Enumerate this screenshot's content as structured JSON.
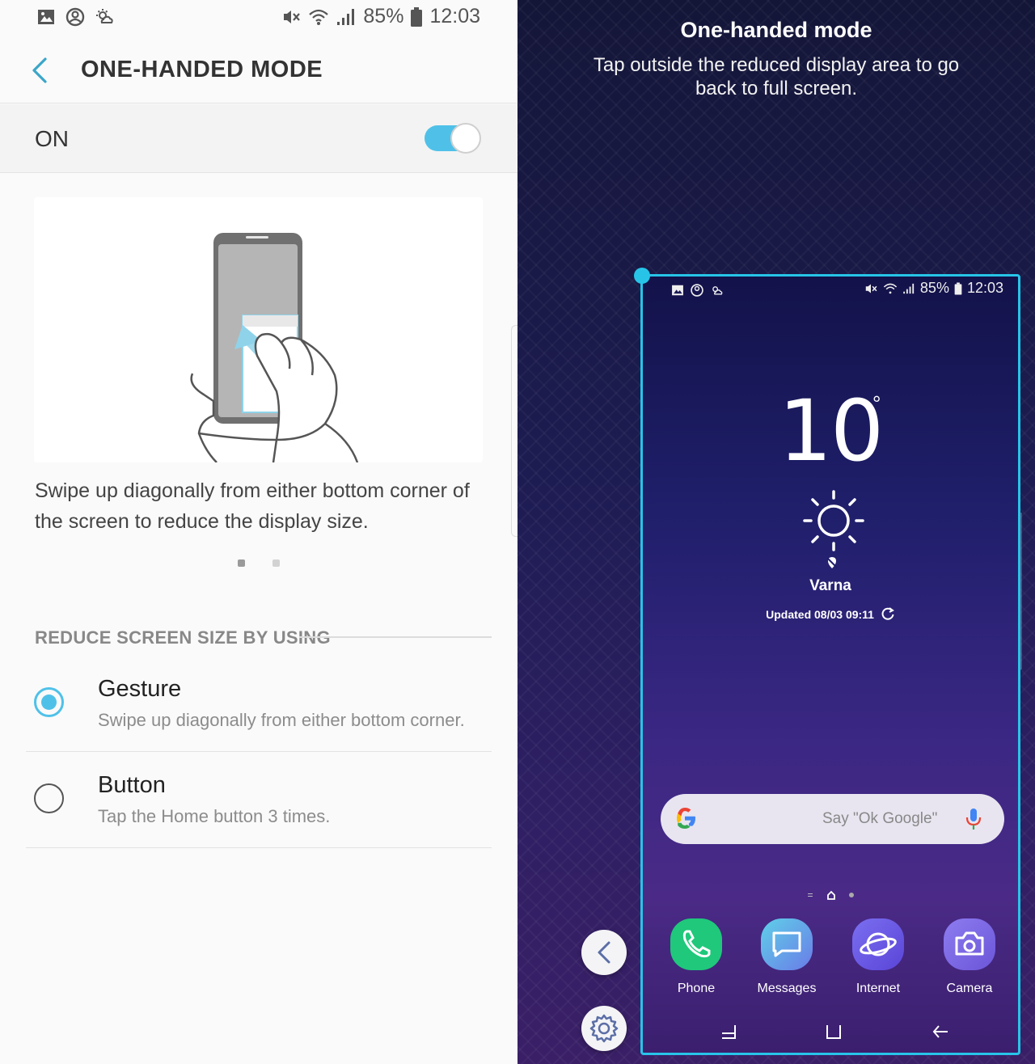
{
  "left": {
    "status": {
      "battery": "85%",
      "time": "12:03"
    },
    "header": {
      "title": "ONE-HANDED MODE"
    },
    "switch": {
      "label": "ON",
      "checked": true,
      "accent": "#4fc1e9"
    },
    "description": "Swipe up diagonally from either bottom corner of the screen to reduce the display size.",
    "pager": {
      "count": 2,
      "active": 0
    },
    "section_title": "REDUCE SCREEN SIZE BY USING",
    "options": [
      {
        "title": "Gesture",
        "subtitle": "Swipe up diagonally from either bottom corner.",
        "selected": true
      },
      {
        "title": "Button",
        "subtitle": "Tap the Home button 3 times.",
        "selected": false
      }
    ]
  },
  "right": {
    "title": "One-handed mode",
    "subtitle": "Tap outside the reduced display area to go back to full screen.",
    "accent": "#27c4e8",
    "mini": {
      "status": {
        "battery": "85%",
        "time": "12:03"
      },
      "weather": {
        "temp": "10",
        "deg": "°",
        "city": "Varna",
        "updated": "Updated 08/03 09:11"
      },
      "search": {
        "hint": "Say \"Ok Google\""
      },
      "apps": [
        {
          "label": "Phone",
          "icon": "phone-icon"
        },
        {
          "label": "Messages",
          "icon": "messages-icon"
        },
        {
          "label": "Internet",
          "icon": "internet-icon"
        },
        {
          "label": "Camera",
          "icon": "camera-icon"
        }
      ]
    }
  }
}
